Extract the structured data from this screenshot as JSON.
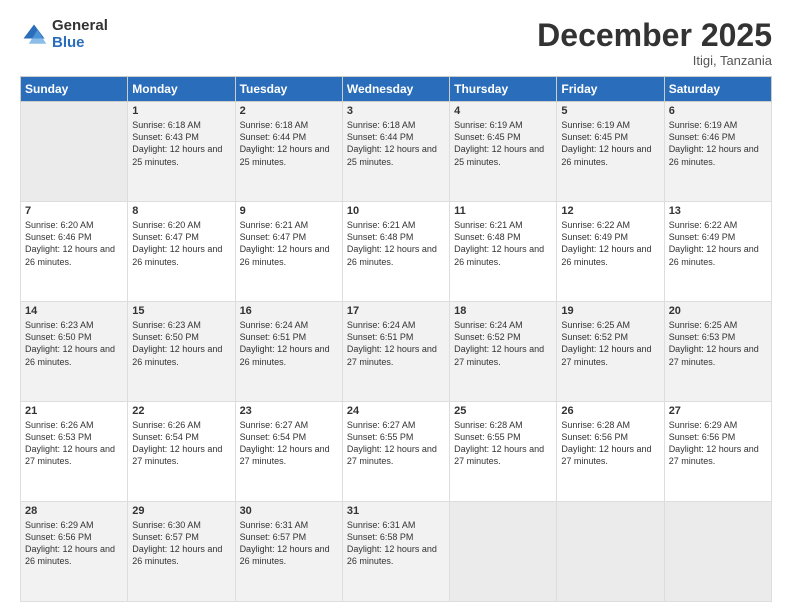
{
  "logo": {
    "general": "General",
    "blue": "Blue"
  },
  "header": {
    "month": "December 2025",
    "location": "Itigi, Tanzania"
  },
  "weekdays": [
    "Sunday",
    "Monday",
    "Tuesday",
    "Wednesday",
    "Thursday",
    "Friday",
    "Saturday"
  ],
  "weeks": [
    [
      {
        "day": "",
        "empty": true
      },
      {
        "day": "1",
        "sunrise": "6:18 AM",
        "sunset": "6:43 PM",
        "daylight": "12 hours and 25 minutes."
      },
      {
        "day": "2",
        "sunrise": "6:18 AM",
        "sunset": "6:44 PM",
        "daylight": "12 hours and 25 minutes."
      },
      {
        "day": "3",
        "sunrise": "6:18 AM",
        "sunset": "6:44 PM",
        "daylight": "12 hours and 25 minutes."
      },
      {
        "day": "4",
        "sunrise": "6:19 AM",
        "sunset": "6:45 PM",
        "daylight": "12 hours and 25 minutes."
      },
      {
        "day": "5",
        "sunrise": "6:19 AM",
        "sunset": "6:45 PM",
        "daylight": "12 hours and 26 minutes."
      },
      {
        "day": "6",
        "sunrise": "6:19 AM",
        "sunset": "6:46 PM",
        "daylight": "12 hours and 26 minutes."
      }
    ],
    [
      {
        "day": "7",
        "sunrise": "6:20 AM",
        "sunset": "6:46 PM",
        "daylight": "12 hours and 26 minutes."
      },
      {
        "day": "8",
        "sunrise": "6:20 AM",
        "sunset": "6:47 PM",
        "daylight": "12 hours and 26 minutes."
      },
      {
        "day": "9",
        "sunrise": "6:21 AM",
        "sunset": "6:47 PM",
        "daylight": "12 hours and 26 minutes."
      },
      {
        "day": "10",
        "sunrise": "6:21 AM",
        "sunset": "6:48 PM",
        "daylight": "12 hours and 26 minutes."
      },
      {
        "day": "11",
        "sunrise": "6:21 AM",
        "sunset": "6:48 PM",
        "daylight": "12 hours and 26 minutes."
      },
      {
        "day": "12",
        "sunrise": "6:22 AM",
        "sunset": "6:49 PM",
        "daylight": "12 hours and 26 minutes."
      },
      {
        "day": "13",
        "sunrise": "6:22 AM",
        "sunset": "6:49 PM",
        "daylight": "12 hours and 26 minutes."
      }
    ],
    [
      {
        "day": "14",
        "sunrise": "6:23 AM",
        "sunset": "6:50 PM",
        "daylight": "12 hours and 26 minutes."
      },
      {
        "day": "15",
        "sunrise": "6:23 AM",
        "sunset": "6:50 PM",
        "daylight": "12 hours and 26 minutes."
      },
      {
        "day": "16",
        "sunrise": "6:24 AM",
        "sunset": "6:51 PM",
        "daylight": "12 hours and 26 minutes."
      },
      {
        "day": "17",
        "sunrise": "6:24 AM",
        "sunset": "6:51 PM",
        "daylight": "12 hours and 27 minutes."
      },
      {
        "day": "18",
        "sunrise": "6:24 AM",
        "sunset": "6:52 PM",
        "daylight": "12 hours and 27 minutes."
      },
      {
        "day": "19",
        "sunrise": "6:25 AM",
        "sunset": "6:52 PM",
        "daylight": "12 hours and 27 minutes."
      },
      {
        "day": "20",
        "sunrise": "6:25 AM",
        "sunset": "6:53 PM",
        "daylight": "12 hours and 27 minutes."
      }
    ],
    [
      {
        "day": "21",
        "sunrise": "6:26 AM",
        "sunset": "6:53 PM",
        "daylight": "12 hours and 27 minutes."
      },
      {
        "day": "22",
        "sunrise": "6:26 AM",
        "sunset": "6:54 PM",
        "daylight": "12 hours and 27 minutes."
      },
      {
        "day": "23",
        "sunrise": "6:27 AM",
        "sunset": "6:54 PM",
        "daylight": "12 hours and 27 minutes."
      },
      {
        "day": "24",
        "sunrise": "6:27 AM",
        "sunset": "6:55 PM",
        "daylight": "12 hours and 27 minutes."
      },
      {
        "day": "25",
        "sunrise": "6:28 AM",
        "sunset": "6:55 PM",
        "daylight": "12 hours and 27 minutes."
      },
      {
        "day": "26",
        "sunrise": "6:28 AM",
        "sunset": "6:56 PM",
        "daylight": "12 hours and 27 minutes."
      },
      {
        "day": "27",
        "sunrise": "6:29 AM",
        "sunset": "6:56 PM",
        "daylight": "12 hours and 27 minutes."
      }
    ],
    [
      {
        "day": "28",
        "sunrise": "6:29 AM",
        "sunset": "6:56 PM",
        "daylight": "12 hours and 26 minutes."
      },
      {
        "day": "29",
        "sunrise": "6:30 AM",
        "sunset": "6:57 PM",
        "daylight": "12 hours and 26 minutes."
      },
      {
        "day": "30",
        "sunrise": "6:31 AM",
        "sunset": "6:57 PM",
        "daylight": "12 hours and 26 minutes."
      },
      {
        "day": "31",
        "sunrise": "6:31 AM",
        "sunset": "6:58 PM",
        "daylight": "12 hours and 26 minutes."
      },
      {
        "day": "",
        "empty": true
      },
      {
        "day": "",
        "empty": true
      },
      {
        "day": "",
        "empty": true
      }
    ]
  ]
}
